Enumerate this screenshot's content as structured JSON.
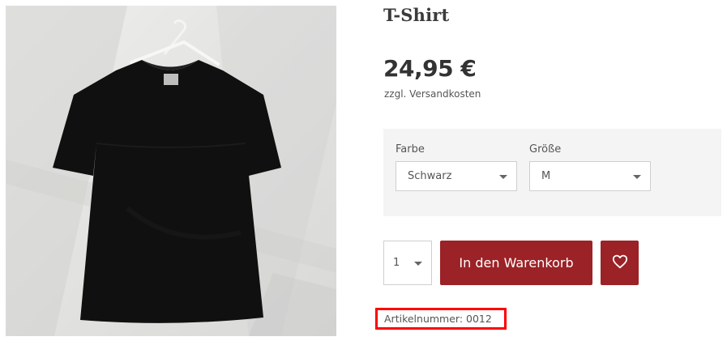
{
  "product": {
    "title": "T-Shirt",
    "price": "24,95 €",
    "shipping_note": "zzgl. Versandkosten",
    "image_alt": "Black T-shirt on hanger"
  },
  "variants": {
    "color_label": "Farbe",
    "color_value": "Schwarz",
    "size_label": "Größe",
    "size_value": "M"
  },
  "purchase": {
    "quantity": "1",
    "cart_label": "In den Warenkorb",
    "wishlist_icon": "heart-icon"
  },
  "meta": {
    "article_number": "Artikelnummer: 0012"
  },
  "colors": {
    "accent": "#9b2226",
    "highlight_border": "#ff0000",
    "panel_bg": "#f4f4f4"
  }
}
